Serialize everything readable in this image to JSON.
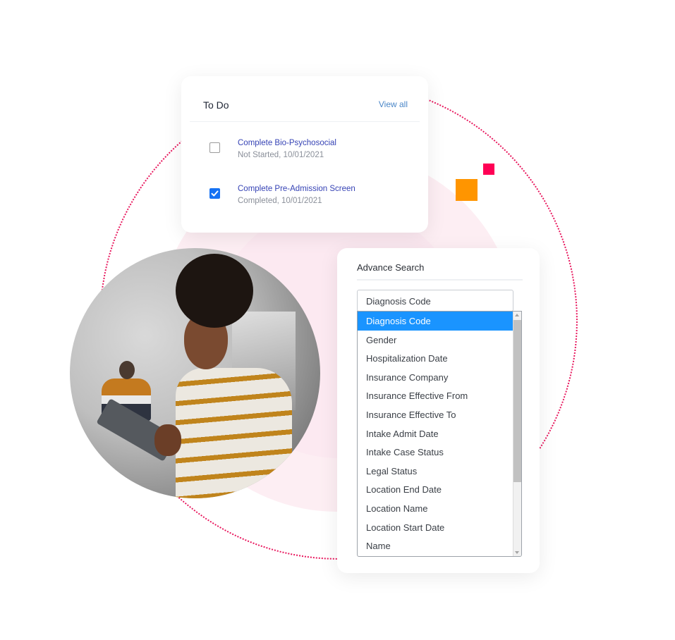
{
  "decor": {
    "accent_pink": "#ff0055",
    "accent_orange": "#ff9500",
    "ring_color": "#e8175d",
    "blob_color": "#fdeef3"
  },
  "todo": {
    "title": "To Do",
    "view_all": "View all",
    "items": [
      {
        "title": "Complete Bio-Psychosocial",
        "status": "Not Started, 10/01/2021",
        "checked": false
      },
      {
        "title": "Complete Pre-Admission Screen",
        "status": "Completed, 10/01/2021",
        "checked": true
      }
    ]
  },
  "photo": {
    "description": "Woman in striped sweater smiling at a tablet in an office"
  },
  "advance_search": {
    "title": "Advance Search",
    "selected_value": "Diagnosis Code",
    "options": [
      "Diagnosis Code",
      "Gender",
      "Hospitalization Date",
      "Insurance Company",
      "Insurance Effective From",
      "Insurance Effective To",
      "Intake Admit Date",
      "Intake Case Status",
      "Legal Status",
      "Location End Date",
      "Location Name",
      "Location Start Date",
      "Name"
    ],
    "highlighted_index": 0
  }
}
